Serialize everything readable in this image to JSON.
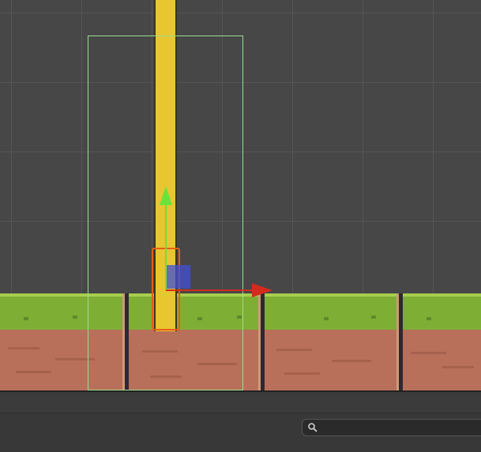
{
  "scene_view": {
    "grid": "on",
    "tiles": [
      "grass-ground-tile",
      "grass-ground-tile",
      "grass-ground-tile",
      "grass-ground-tile"
    ],
    "selected_object": "light-beam-sprite",
    "gizmo": {
      "tool": "move",
      "axes": [
        "x",
        "y"
      ]
    },
    "colors": {
      "background": "#474747",
      "grass": "#7fae35",
      "dirt": "#b8705b",
      "light_beam": "#e7c62f",
      "selection_outline": "#e85d17",
      "bounds_outline": "#98e08d",
      "x_axis": "#d42b1e",
      "y_axis": "#6be23a"
    }
  },
  "search": {
    "value": "",
    "placeholder": "",
    "icon": "magnifier-icon"
  }
}
